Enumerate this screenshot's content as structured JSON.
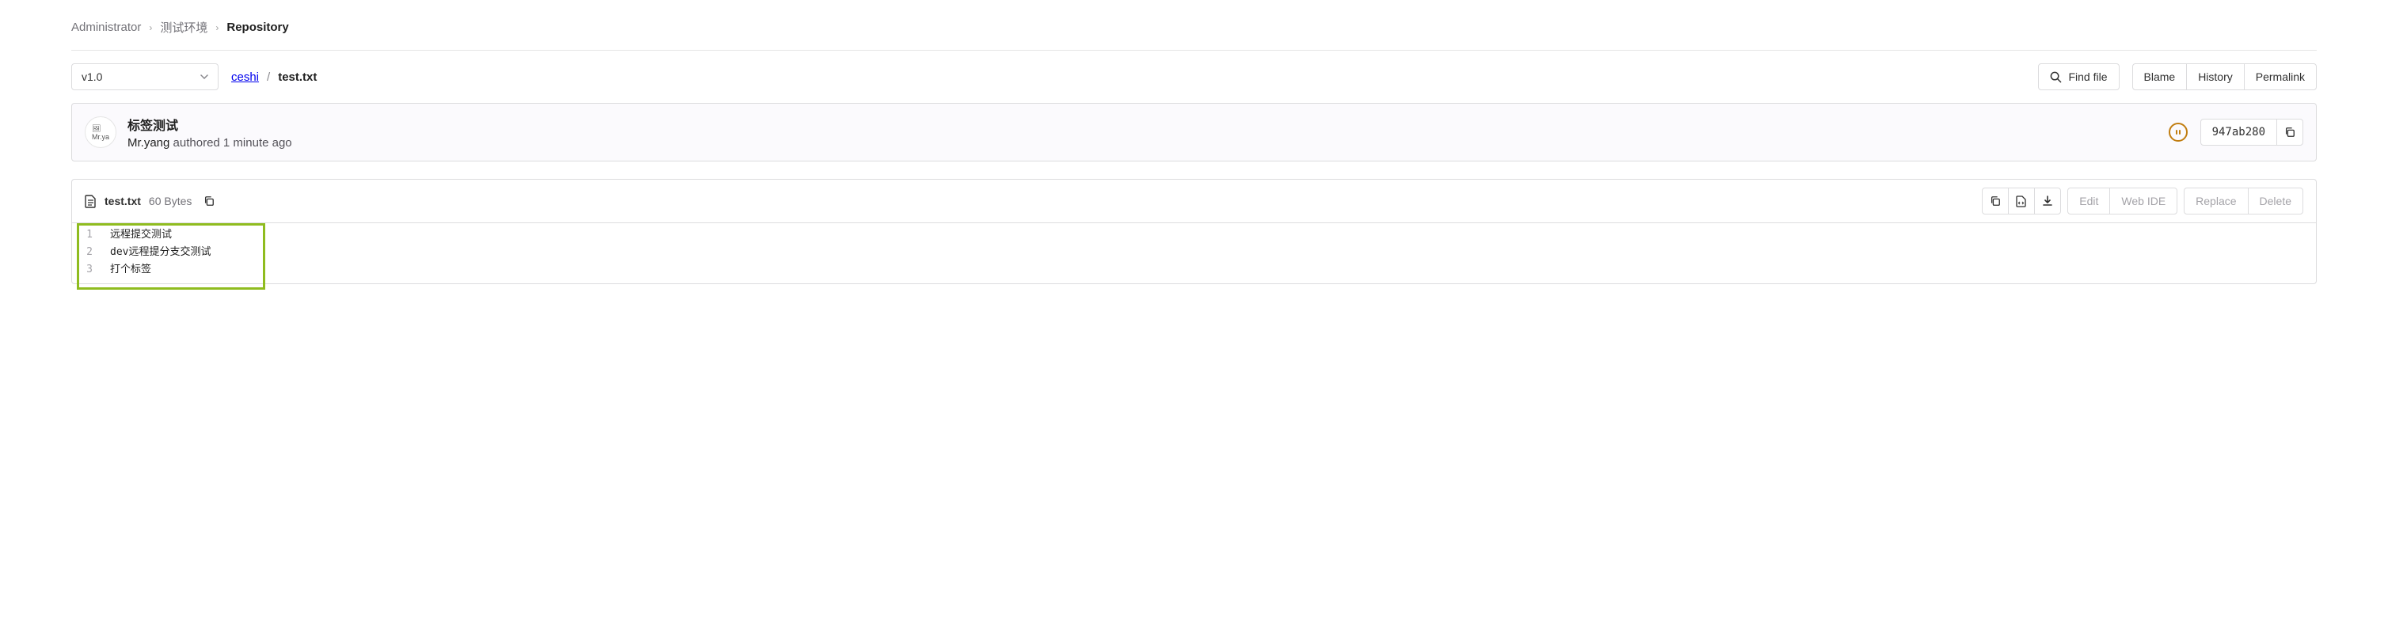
{
  "breadcrumbs": [
    {
      "label": "Administrator",
      "current": false
    },
    {
      "label": "测试环境",
      "current": false
    },
    {
      "label": "Repository",
      "current": true
    }
  ],
  "branchSelector": {
    "value": "v1.0"
  },
  "path": {
    "dir": "ceshi",
    "file": "test.txt"
  },
  "actions": {
    "findFile": "Find file",
    "blame": "Blame",
    "history": "History",
    "permalink": "Permalink"
  },
  "commit": {
    "title": "标签测试",
    "author": "Mr.yang",
    "action": "authored",
    "time": "1 minute ago",
    "avatarAlt": "Mr.ya",
    "sha": "947ab280"
  },
  "file": {
    "name": "test.txt",
    "size": "60 Bytes"
  },
  "fileActions": {
    "edit": "Edit",
    "webIde": "Web IDE",
    "replace": "Replace",
    "delete": "Delete"
  },
  "code": [
    "远程提交测试",
    "dev远程提分支交测试",
    "打个标签"
  ]
}
